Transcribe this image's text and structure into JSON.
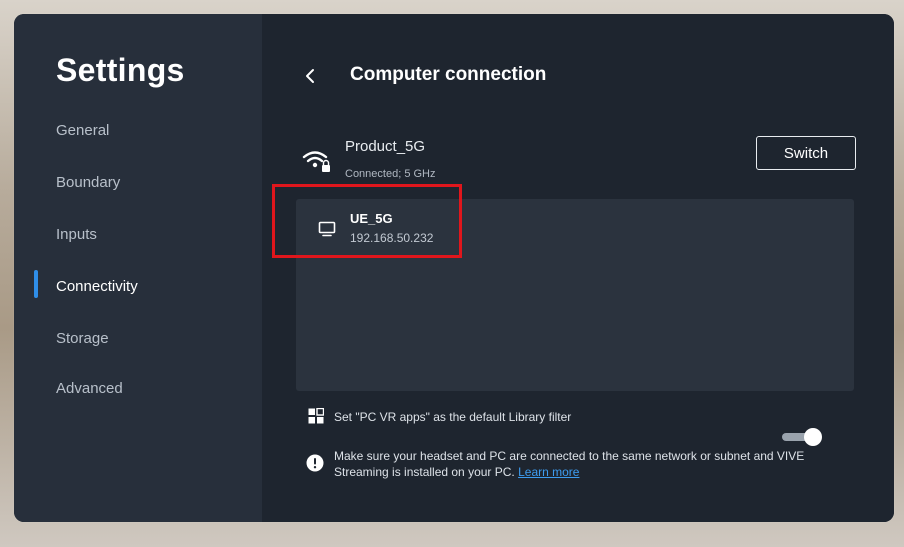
{
  "sidebar": {
    "title": "Settings",
    "items": [
      {
        "label": "General"
      },
      {
        "label": "Boundary"
      },
      {
        "label": "Inputs"
      },
      {
        "label": "Connectivity",
        "active": true
      },
      {
        "label": "Storage"
      },
      {
        "label": "Advanced"
      }
    ]
  },
  "header": {
    "back_icon": "chevron-left-icon",
    "title": "Computer connection"
  },
  "network": {
    "icon": "wifi-lock-icon",
    "name": "Product_5G",
    "status": "Connected; 5 GHz",
    "switch_label": "Switch"
  },
  "devices": [
    {
      "icon": "monitor-icon",
      "name": "UE_5G",
      "ip": "192.168.50.232",
      "highlighted": true
    }
  ],
  "library_filter": {
    "icon": "grid-icon",
    "label": "Set \"PC VR apps\" as the default Library filter",
    "enabled": true
  },
  "info": {
    "icon": "info-icon",
    "text": "Make sure your headset and PC are connected to the same network or subnet and VIVE Streaming is installed on your PC.",
    "link_label": "Learn more"
  },
  "colors": {
    "accent": "#2f8ee8",
    "highlight": "#e0161c",
    "link": "#3d9cf0"
  }
}
